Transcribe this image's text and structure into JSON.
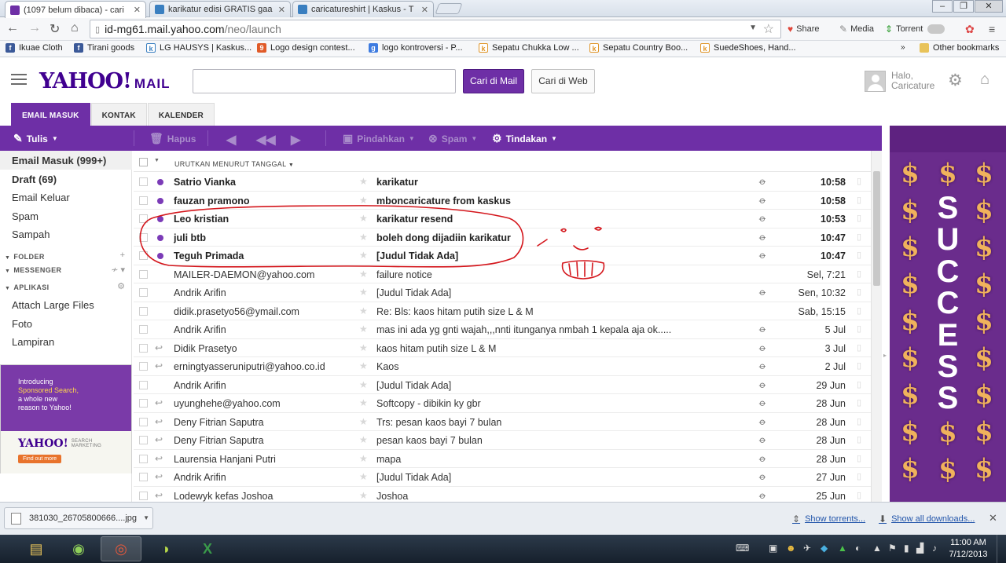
{
  "browser": {
    "tabs": [
      {
        "title": "(1097 belum dibaca) - cari",
        "icon": "yahoo-mail-icon",
        "color": "#6e2fa6",
        "active": true
      },
      {
        "title": "karikatur edisi GRATIS gaa",
        "icon": "kaskus-icon",
        "color": "#3a7fc0",
        "active": false
      },
      {
        "title": "caricatureshirt | Kaskus - T",
        "icon": "kaskus-icon",
        "color": "#3a7fc0",
        "active": false
      }
    ],
    "url_host": "id-mg61.mail.yahoo.com",
    "url_path": "/neo/launch",
    "extensions": [
      {
        "label": "Share",
        "icon": "share-icon"
      },
      {
        "label": "Media",
        "icon": "media-icon"
      },
      {
        "label": "Torrent",
        "icon": "torrent-icon"
      }
    ],
    "bookmarks": [
      {
        "label": "Ikuae Cloth",
        "icon": "facebook-icon",
        "color": "#3b5998"
      },
      {
        "label": "Tirani goods",
        "icon": "facebook-icon",
        "color": "#3b5998"
      },
      {
        "label": "LG HAUSYS | Kaskus...",
        "icon": "kaskus-icon",
        "color": "#3a7fc0"
      },
      {
        "label": "Logo design contest...",
        "icon": "99designs-icon",
        "color": "#e05a28"
      },
      {
        "label": "logo kontroversi - P...",
        "icon": "google-icon",
        "color": "#3d7be0"
      },
      {
        "label": "Sepatu Chukka Low ...",
        "icon": "kaskus-icon",
        "color": "#e0962a"
      },
      {
        "label": "Sepatu Country Boo...",
        "icon": "kaskus-icon",
        "color": "#e0962a"
      },
      {
        "label": "SuedeShoes, Hand...",
        "icon": "kaskus-icon",
        "color": "#e0962a"
      }
    ],
    "other_bookmarks": "Other bookmarks"
  },
  "header": {
    "logo": "YAHOO!",
    "logo_product": "MAIL",
    "search_placeholder": "",
    "search_mail_label": "Cari di Mail",
    "search_web_label": "Cari di Web",
    "greeting_line1": "Halo,",
    "greeting_line2": "Caricature"
  },
  "tabs": [
    {
      "label": "EMAIL MASUK",
      "active": true
    },
    {
      "label": "KONTAK",
      "active": false
    },
    {
      "label": "KALENDER",
      "active": false
    }
  ],
  "toolbar": {
    "compose": "Tulis",
    "delete": "Hapus",
    "move": "Pindahkan",
    "spam": "Spam",
    "actions": "Tindakan"
  },
  "sidebar": {
    "folders": [
      {
        "label": "Email Masuk (999+)",
        "bold": true,
        "selected": true
      },
      {
        "label": "Draft (69)",
        "bold": true,
        "selected": false
      },
      {
        "label": "Email Keluar",
        "bold": false,
        "selected": false
      },
      {
        "label": "Spam",
        "bold": false,
        "selected": false
      },
      {
        "label": "Sampah",
        "bold": false,
        "selected": false
      }
    ],
    "section_folder": "FOLDER",
    "section_messenger": "MESSENGER",
    "section_apps": "APLIKASI",
    "apps": [
      "Attach Large Files",
      "Foto",
      "Lampiran"
    ],
    "promo": {
      "line1": "Introducing",
      "line2": "Sponsored Search,",
      "line3": "a whole new",
      "line4": "reason to Yahoo!",
      "logo": "YAHOO!",
      "logo_sub1": "SEARCH",
      "logo_sub2": "MARKETING",
      "button": "Find out more"
    }
  },
  "list": {
    "sort_label": "URUTKAN MENURUT TANGGAL",
    "messages": [
      {
        "from": "Satrio Vianka",
        "subject": "karikatur",
        "date": "10:58",
        "unread": true,
        "attachment": true,
        "replied": false
      },
      {
        "from": "fauzan pramono",
        "subject": "mboncaricature from kaskus",
        "date": "10:58",
        "unread": true,
        "attachment": true,
        "replied": false
      },
      {
        "from": "Leo kristian",
        "subject": "karikatur resend",
        "date": "10:53",
        "unread": true,
        "attachment": true,
        "replied": false
      },
      {
        "from": "juli btb",
        "subject": "boleh dong dijadiin karikatur",
        "date": "10:47",
        "unread": true,
        "attachment": true,
        "replied": false
      },
      {
        "from": "Teguh Primada",
        "subject": "[Judul Tidak Ada]",
        "date": "10:47",
        "unread": true,
        "attachment": true,
        "replied": false
      },
      {
        "from": "MAILER-DAEMON@yahoo.com",
        "subject": "failure notice",
        "date": "Sel, 7:21",
        "unread": false,
        "attachment": false,
        "replied": false
      },
      {
        "from": "Andrik Arifin",
        "subject": "[Judul Tidak Ada]",
        "date": "Sen, 10:32",
        "unread": false,
        "attachment": true,
        "replied": false
      },
      {
        "from": "didik.prasetyo56@ymail.com",
        "subject": "Re: Bls: kaos hitam putih size L & M",
        "date": "Sab, 15:15",
        "unread": false,
        "attachment": false,
        "replied": false
      },
      {
        "from": "Andrik Arifin",
        "subject": "mas ini ada yg gnti wajah,,,nnti itunganya nmbah 1 kepala aja ok.....",
        "date": "5 Jul",
        "unread": false,
        "attachment": true,
        "replied": false
      },
      {
        "from": "Didik Prasetyo",
        "subject": "kaos hitam putih size L & M",
        "date": "3 Jul",
        "unread": false,
        "attachment": true,
        "replied": true
      },
      {
        "from": "erningtyasseruniputri@yahoo.co.id",
        "subject": "Kaos",
        "date": "2 Jul",
        "unread": false,
        "attachment": true,
        "replied": true
      },
      {
        "from": "Andrik Arifin",
        "subject": "[Judul Tidak Ada]",
        "date": "29 Jun",
        "unread": false,
        "attachment": true,
        "replied": false
      },
      {
        "from": "uyunghehe@yahoo.com",
        "subject": "Softcopy - dibikin ky gbr",
        "date": "28 Jun",
        "unread": false,
        "attachment": true,
        "replied": true
      },
      {
        "from": "Deny Fitrian Saputra",
        "subject": "Trs: pesan kaos bayi 7 bulan",
        "date": "28 Jun",
        "unread": false,
        "attachment": true,
        "replied": true
      },
      {
        "from": "Deny Fitrian Saputra",
        "subject": "pesan kaos bayi 7 bulan",
        "date": "28 Jun",
        "unread": false,
        "attachment": true,
        "replied": true
      },
      {
        "from": "Laurensia Hanjani Putri",
        "subject": "mapa",
        "date": "28 Jun",
        "unread": false,
        "attachment": true,
        "replied": true
      },
      {
        "from": "Andrik Arifin",
        "subject": "[Judul Tidak Ada]",
        "date": "27 Jun",
        "unread": false,
        "attachment": true,
        "replied": true
      },
      {
        "from": "Lodewyk kefas Joshoa",
        "subject": "Joshoa",
        "date": "25 Jun",
        "unread": false,
        "attachment": true,
        "replied": true
      }
    ]
  },
  "ad": {
    "word": "SUCCESS",
    "accent": "#f0b25c",
    "background": "#6a2c8c"
  },
  "downloads": {
    "file": "381030_26705800666....jpg",
    "show_torrents": "Show torrents...",
    "show_all": "Show all downloads..."
  },
  "taskbar": {
    "time": "11:00 AM",
    "date": "7/12/2013"
  },
  "colors": {
    "brand_purple": "#6e2fa6",
    "unread_dot": "#7b3bb7",
    "annotation_red": "#d4161c"
  }
}
